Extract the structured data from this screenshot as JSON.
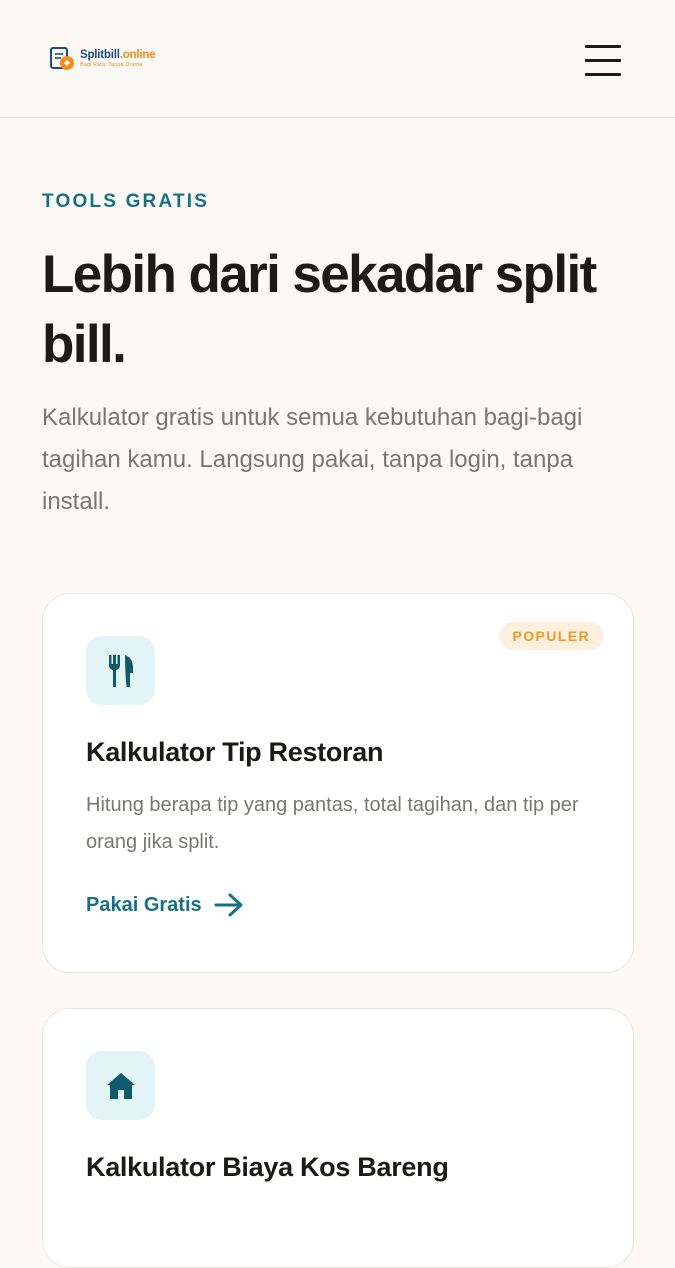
{
  "header": {
    "logo_name_primary": "Splitbill",
    "logo_name_accent": ".online",
    "logo_tagline": "Bagi Rata, Tanpa Drama"
  },
  "hero": {
    "eyebrow": "TOOLS GRATIS",
    "title": "Lebih dari sekadar split bill.",
    "subtitle": "Kalkulator gratis untuk semua kebutuhan bagi-bagi tagihan kamu. Langsung pakai, tanpa login, tanpa install."
  },
  "tools": [
    {
      "icon": "fork-knife-icon",
      "badge": "POPULER",
      "title": "Kalkulator Tip Restoran",
      "description": "Hitung berapa tip yang pantas, total tagihan, dan tip per orang jika split.",
      "cta": "Pakai Gratis"
    },
    {
      "icon": "house-icon",
      "title": "Kalkulator Biaya Kos Bareng"
    }
  ],
  "colors": {
    "background": "#fcf8f5",
    "accent_teal": "#167282",
    "badge_orange": "#ef9a24",
    "icon_bg": "#e3f4f6"
  }
}
